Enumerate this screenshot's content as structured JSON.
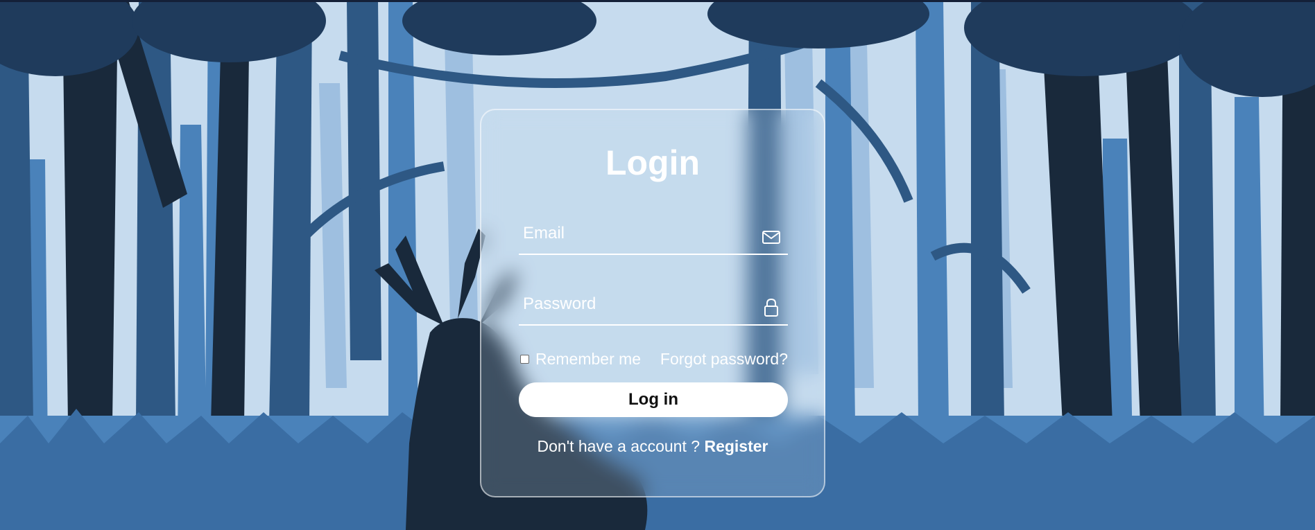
{
  "login": {
    "title": "Login",
    "email_placeholder": "Email",
    "password_placeholder": "Password",
    "remember_label": "Remember me",
    "forgot_label": "Forgot password?",
    "login_button_label": "Log in",
    "register_prompt": "Don't have a account ?",
    "register_label": "Register"
  },
  "icons": {
    "email": "envelope-icon",
    "password": "lock-icon"
  },
  "colors": {
    "sky": "#c6dbee",
    "text": "#ffffff",
    "button_bg": "#ffffff",
    "button_text": "#111111",
    "dark_tree": "#19293b",
    "mid_tree": "#2e5884",
    "light_tree": "#4a82ba"
  }
}
